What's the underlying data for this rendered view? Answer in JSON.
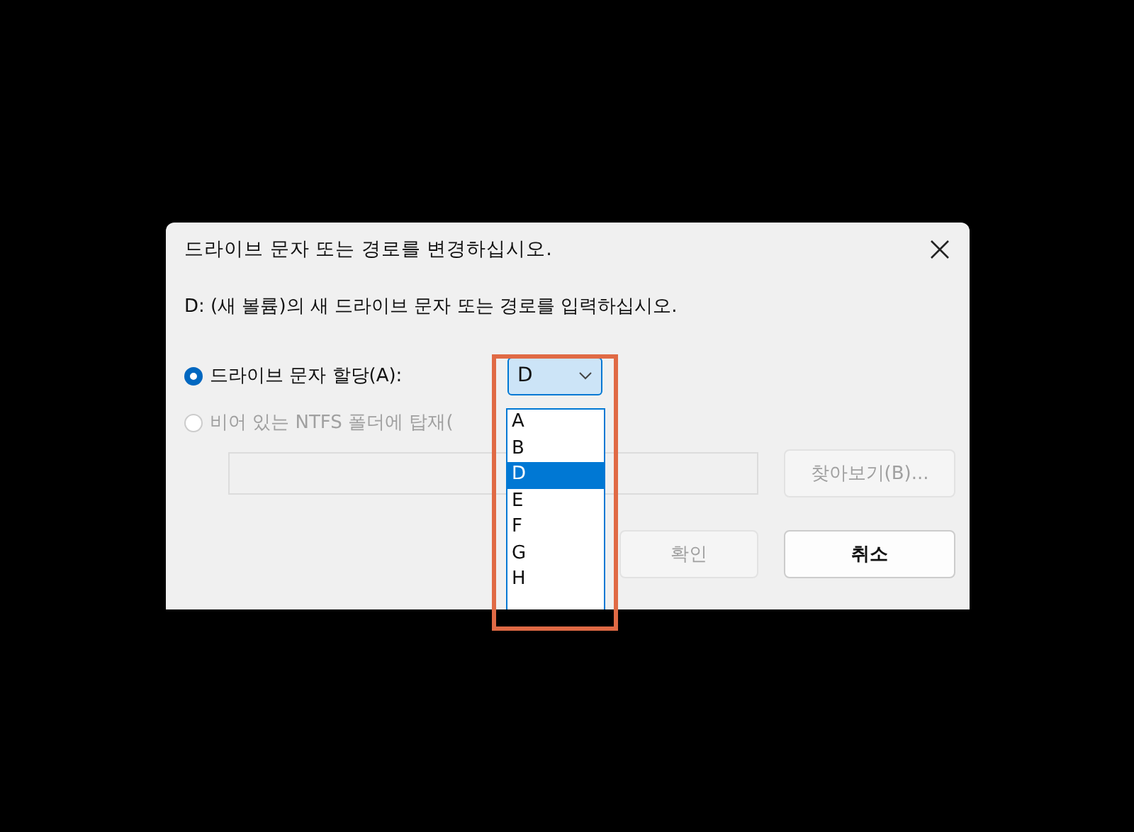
{
  "dialog": {
    "title": "드라이브 문자 또는 경로를 변경하십시오.",
    "prompt": "D: (새 볼륨)의 새 드라이브 문자 또는 경로를 입력하십시오.",
    "options": [
      {
        "label": "드라이브 문자 할당(A):",
        "selected": true,
        "disabled": false
      },
      {
        "label": "비어 있는 NTFS 폴더에 탑재(",
        "selected": false,
        "disabled": true
      }
    ],
    "drive_select": {
      "value": "D",
      "expanded": true,
      "options": [
        {
          "label": "A",
          "selected": false
        },
        {
          "label": "B",
          "selected": false
        },
        {
          "label": "D",
          "selected": true
        },
        {
          "label": "E",
          "selected": false
        },
        {
          "label": "F",
          "selected": false
        },
        {
          "label": "G",
          "selected": false
        },
        {
          "label": "H",
          "selected": false
        }
      ]
    },
    "path_field": {
      "disabled": true
    },
    "browse_button": {
      "label": "찾아보기(B)...",
      "disabled": true
    },
    "buttons": [
      {
        "label": "확인",
        "disabled": true,
        "default": false
      },
      {
        "label": "취소",
        "disabled": false,
        "default": true
      }
    ]
  }
}
